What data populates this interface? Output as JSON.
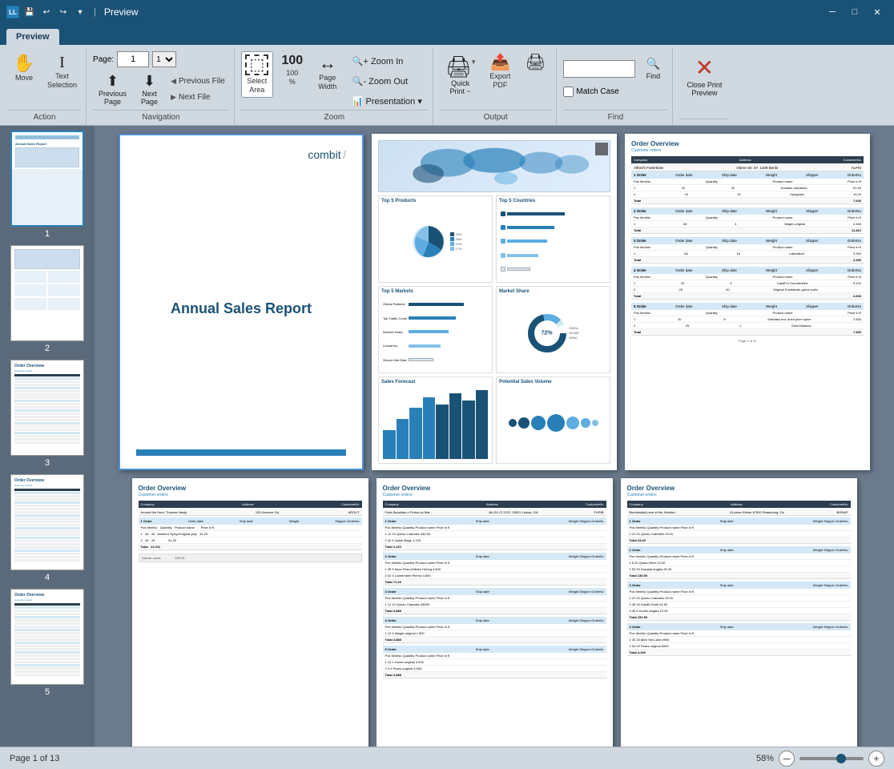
{
  "titlebar": {
    "title": "Preview",
    "app_icon": "LL",
    "quick_access": [
      "save",
      "undo",
      "redo",
      "dropdown"
    ],
    "window_controls": {
      "minimize": "─",
      "maximize": "□",
      "close": "✕"
    }
  },
  "ribbon_tabs": [
    {
      "id": "preview",
      "label": "Preview",
      "active": true
    }
  ],
  "ribbon": {
    "groups": [
      {
        "id": "action",
        "label": "Action",
        "buttons": [
          {
            "id": "move",
            "icon": "✋",
            "label": "Move"
          },
          {
            "id": "text-selection",
            "icon": "𝖨",
            "label": "Text\nSelection"
          }
        ]
      },
      {
        "id": "navigation",
        "label": "Navigation",
        "page_label": "Page:",
        "page_value": "1",
        "prev_page_label": "Previous\nPage",
        "next_page_label": "Next\nPage",
        "prev_file_label": "Previous File",
        "next_file_label": "Next File"
      },
      {
        "id": "zoom",
        "label": "Zoom",
        "buttons": [
          {
            "id": "select-area",
            "icon": "⬚",
            "label": "Select\nArea",
            "active": true
          },
          {
            "id": "zoom-100",
            "icon": "100",
            "label": "100\n%"
          },
          {
            "id": "page-width",
            "icon": "⇔",
            "label": "Page\nWidth"
          }
        ],
        "zoom_in_label": "Zoom In",
        "zoom_out_label": "Zoom Out",
        "presentation_label": "Presentation ▾"
      },
      {
        "id": "output",
        "label": "Output",
        "buttons": [
          {
            "id": "quick-print",
            "icon": "🖨",
            "label": "Quick\nPrint ~"
          },
          {
            "id": "export",
            "icon": "📤",
            "label": "Export\nPDF"
          },
          {
            "id": "print-direct",
            "icon": "🖨",
            "label": ""
          }
        ]
      },
      {
        "id": "find",
        "label": "Find",
        "search_placeholder": "",
        "find_label": "Find",
        "match_case_label": "Match Case"
      },
      {
        "id": "close",
        "label": "",
        "close_label": "Close Print\nPreview",
        "close_icon": "✕"
      }
    ]
  },
  "thumbnail_sidebar": {
    "pages": [
      {
        "number": "1",
        "selected": true
      },
      {
        "number": "2",
        "selected": false
      },
      {
        "number": "3",
        "selected": false
      },
      {
        "number": "4",
        "selected": false
      },
      {
        "number": "5",
        "selected": false
      }
    ]
  },
  "preview": {
    "pages": [
      {
        "id": "page1",
        "type": "annual-sales",
        "title": "Annual Sales Report"
      },
      {
        "id": "page2",
        "type": "dashboard",
        "sections": [
          "Top 5 Products",
          "Top 5 Countries",
          "Top 5 Markets",
          "Market Share",
          "Sales Forecast",
          "Potential Sales Volume"
        ]
      },
      {
        "id": "page3",
        "type": "order-overview",
        "title": "Order Overview",
        "subtitle": "Customer orders"
      },
      {
        "id": "page4",
        "type": "order-overview",
        "title": "Order Overview",
        "subtitle": "Customer orders"
      },
      {
        "id": "page5",
        "type": "order-overview",
        "title": "Order Overview",
        "subtitle": "Customer orders"
      },
      {
        "id": "page6",
        "type": "order-overview",
        "title": "Order Overview",
        "subtitle": "Customer orders"
      }
    ]
  },
  "status_bar": {
    "page_info": "Page 1 of 13",
    "zoom_level": "58%",
    "zoom_minus": "─",
    "zoom_plus": "+"
  }
}
